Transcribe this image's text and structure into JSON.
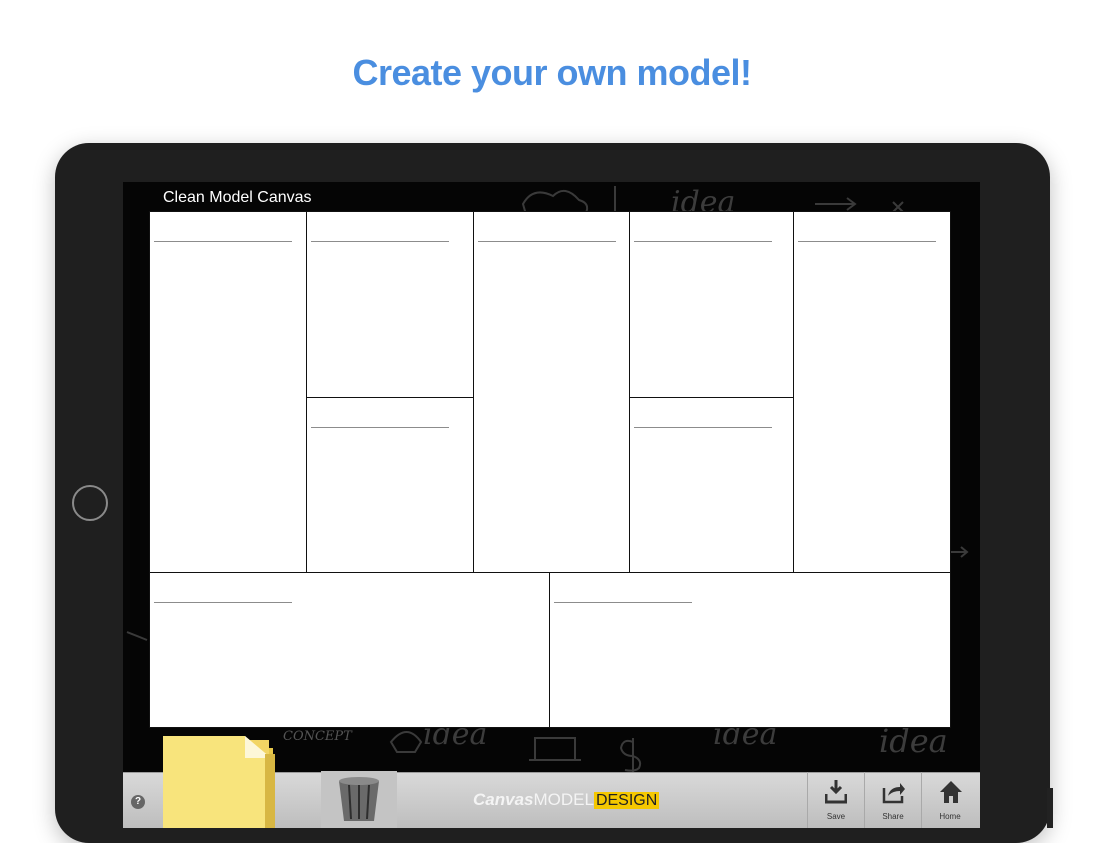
{
  "headline": "Create your own model!",
  "app": {
    "canvas_title": "Clean Model Canvas",
    "logo": {
      "part1": "Canvas",
      "part2": "MODEL",
      "part3": "DESIGN"
    },
    "toolbar": {
      "help": "?",
      "save_label": "Save",
      "share_label": "Share",
      "home_label": "Home"
    },
    "background_doodles": [
      "idea",
      "CONCEPT",
      "idea",
      "idea"
    ]
  },
  "colors": {
    "headline": "#4a8ee0",
    "device": "#1f1f1f",
    "screen_bg": "#050505",
    "folder": "#f7e27a",
    "logo_highlight": "#f5c800"
  },
  "icons": [
    "home-button-icon",
    "folder-icon",
    "trash-icon",
    "download-icon",
    "share-icon",
    "home-icon",
    "help-icon"
  ]
}
